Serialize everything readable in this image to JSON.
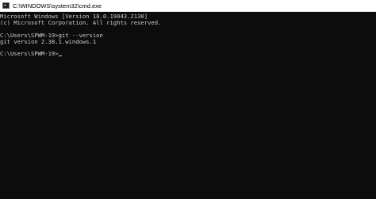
{
  "window": {
    "title": "C:\\WINDOWS\\system32\\cmd.exe",
    "icon": "cmd-icon"
  },
  "console": {
    "lines": [
      "Microsoft Windows [Version 10.0.19043.2130]",
      "(c) Microsoft Corporation. All rights reserved.",
      "",
      "C:\\Users\\SPWM-19>git --version",
      "git version 2.38.1.windows.1",
      "",
      "C:\\Users\\SPWM-19>"
    ]
  },
  "colors": {
    "console_background": "#0c0c0c",
    "console_text": "#cccccc",
    "titlebar_background": "#ffffff"
  }
}
